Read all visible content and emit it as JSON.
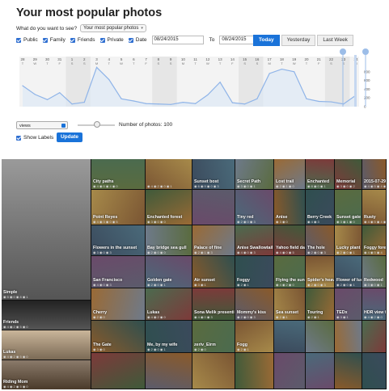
{
  "page": {
    "title": "Your most popular photos"
  },
  "query": {
    "prompt": "What do you want to see?",
    "selected": "Your most popular photos"
  },
  "filters": [
    {
      "label": "Public"
    },
    {
      "label": "Family"
    },
    {
      "label": "Friends"
    },
    {
      "label": "Private"
    },
    {
      "label": "Date"
    }
  ],
  "date": {
    "from": "08/24/2015",
    "to_label": "To",
    "to": "08/24/2015"
  },
  "range_buttons": {
    "today": "Today",
    "yesterday": "Yesterday",
    "last_week": "Last Week"
  },
  "chart_data": {
    "type": "area",
    "x_top": [
      "28",
      "29",
      "30",
      "31",
      "1",
      "2",
      "3",
      "4",
      "5",
      "6",
      "7",
      "8",
      "9",
      "10",
      "11",
      "12",
      "13",
      "14",
      "15",
      "16",
      "17",
      "18",
      "19",
      "20",
      "21",
      "22",
      "23",
      "24"
    ],
    "x_bottom": [
      "T",
      "W",
      "T",
      "F",
      "S",
      "S",
      "M",
      "T",
      "W",
      "T",
      "F",
      "S",
      "S",
      "M",
      "T",
      "W",
      "T",
      "F",
      "S",
      "S",
      "M",
      "T",
      "W",
      "T",
      "F",
      "S",
      "S",
      "M"
    ],
    "values": [
      480,
      280,
      160,
      320,
      60,
      100,
      900,
      620,
      180,
      130,
      70,
      60,
      50,
      100,
      70,
      270,
      560,
      90,
      60,
      180,
      760,
      860,
      800,
      180,
      120,
      110,
      60,
      260
    ],
    "yticks": [
      "800",
      "600",
      "400",
      "200",
      "0"
    ],
    "ylim": [
      0,
      1000
    ]
  },
  "controls": {
    "metric": "views",
    "photos_label": "Number of photos: 100",
    "show_labels": "Show Labels",
    "update": "Update"
  },
  "photos": [
    {
      "caption": "City paths",
      "meta": "◉ 4 ◉ 5 ◉ 4 ◉ 0"
    },
    {
      "caption": "",
      "meta": "◉ 4 ◉ 2 ◉ 0 ◉ 1"
    },
    {
      "caption": "Sunset bost",
      "meta": "◉ 6 ◉ 9 ◉ 0 ◉ 3"
    },
    {
      "caption": "Secret Path",
      "meta": "◉ 3 ◉ 0 ◉ 1"
    },
    {
      "caption": "Lost trail",
      "meta": "◉ 2 ◉ 1 ◉ 0"
    },
    {
      "caption": "Enchanted",
      "meta": "◉ 8 ◉ 0 ◉ 1"
    },
    {
      "caption": "Memorial",
      "meta": "◉ 3 ◉ 0 ◉ 2"
    },
    {
      "caption": "2015-07-29_05-37-26",
      "meta": "◉ 4 ◉ 5 ◉ 4 ◉ 0"
    },
    {
      "caption": "Point Reyes",
      "meta": "◉ 4 ◉ 3 ◉ 0 ◉ 5"
    },
    {
      "caption": "Enchanted forest",
      "meta": "◉ 3 ◉ 0 ◉ 0"
    },
    {
      "caption": "",
      "meta": ""
    },
    {
      "caption": "Tiny red",
      "meta": "◉ 2 ◉ 0 ◉ 3"
    },
    {
      "caption": "Anise",
      "meta": "◉ 3 ◉ 0"
    },
    {
      "caption": "Berry Creek",
      "meta": "◉ 4 ◉ 3"
    },
    {
      "caption": "Sunset gate",
      "meta": "◉ 3 ◉ 1 ◉ 0"
    },
    {
      "caption": "Rusty",
      "meta": "◉ 4 ◉ 5 ◉ 4 ◉ 0"
    },
    {
      "caption": "Flowers in the sunset",
      "meta": "◉ 3 ◉ 0 ◉ 3"
    },
    {
      "caption": "Bay bridge sea gull",
      "meta": "◉ 2 ◉ 0 ◉ 0"
    },
    {
      "caption": "Palace of fine",
      "meta": "◉ 2 ◉ 1 ◉ 3"
    },
    {
      "caption": "Anise Swallowtail",
      "meta": "◉ 4 ◉ 0 ◉ 3"
    },
    {
      "caption": "Simple",
      "meta": "◉ 5 ◉ 0 ◉ 8 ◉ 1"
    },
    {
      "caption": "Yahoo field day",
      "meta": "◉ 4 ◉ 0 ◉ 5"
    },
    {
      "caption": "The hole",
      "meta": "◉ 2 ◉ 0 ◉ 3"
    },
    {
      "caption": "Lucky plant",
      "meta": "◉ 2 ◉ 0 ◉ 1"
    },
    {
      "caption": "Foggy forest",
      "meta": "◉ 4 ◉ 5 ◉ 4"
    },
    {
      "caption": "San Francisco",
      "meta": "◉ 4 ◉ 0 ◉ 3"
    },
    {
      "caption": "Golden gate",
      "meta": "◉ 2 ◉ 0 ◉ 1"
    },
    {
      "caption": "Air sunset",
      "meta": "◉ 3 ◉ 1"
    },
    {
      "caption": "Foggy",
      "meta": "◉ 2 ◉ 1"
    },
    {
      "caption": "Friends",
      "meta": "◉ 4 ◉ 2 ◉ 5 ◉ 0"
    },
    {
      "caption": "Flying the sunset",
      "meta": "◉ 4 ◉ 2 ◉ 0"
    },
    {
      "caption": "Spider's heaven",
      "meta": "◉ 2 ◉ 0 ◉ 3"
    },
    {
      "caption": "Flower of luck",
      "meta": "◉ 2 ◉ 0 ◉ 1"
    },
    {
      "caption": "Redwood",
      "meta": "◉ 3 ◉ 0 ◉ 1"
    },
    {
      "caption": "Cherry",
      "meta": "◉ 2 ◉ 0"
    },
    {
      "caption": "Lukas",
      "meta": "◉ 4 ◉ 2 ◉ 5 ◉ 0"
    },
    {
      "caption": "Lukas",
      "meta": "◉ 4 ◉ 2 ◉ 0"
    },
    {
      "caption": "Sona Melik presenting",
      "meta": "◉ 4 ◉ 0 ◉ 3"
    },
    {
      "caption": "Mommy's kiss",
      "meta": "◉ 2 ◉ 0 ◉ 3"
    },
    {
      "caption": "Sea sunset",
      "meta": "◉ 2 ◉ 1"
    },
    {
      "caption": "Touring",
      "meta": "◉ 2 ◉ 1"
    },
    {
      "caption": "TEDx",
      "meta": "◉ 3 ◉ 1"
    },
    {
      "caption": "Riding Mom",
      "meta": "◉ 4 ◉ 2 ◉ 5 ◉ 0"
    },
    {
      "caption": "HDR view from @YahooHQ",
      "meta": "◉ 4 ◉ 2 ◉ 0"
    },
    {
      "caption": "The Gate",
      "meta": "◉ 3 ◉ 0"
    },
    {
      "caption": "Me, by my wife",
      "meta": "◉ 2 ◉ 0 ◉ 1"
    },
    {
      "caption": "zeriv_Eirm",
      "meta": "◉ 2 ◉ 0"
    },
    {
      "caption": "Fogg",
      "meta": "◉ 2 ◉ 1"
    }
  ]
}
